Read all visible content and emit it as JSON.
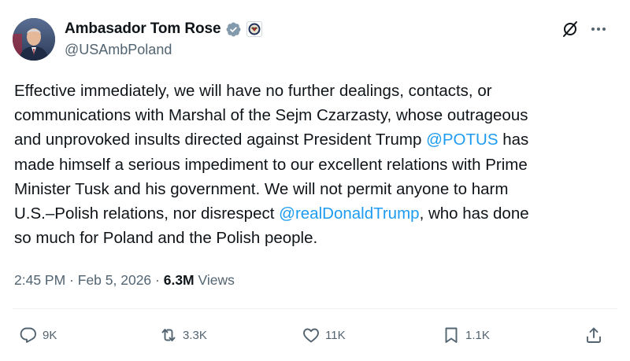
{
  "author": {
    "display_name": "Ambasador Tom Rose",
    "handle": "@USAmbPoland",
    "verified_icon": "verified-badge-icon",
    "affiliation_icon": "embassy-seal-icon"
  },
  "tweet": {
    "lines": [
      [
        "Effective immediately, we will have no further dealings, contacts, or"
      ],
      [
        "communications with Marshal of the Sejm Czarzasty, whose outrageous"
      ],
      [
        "and unprovoked insults directed  against President Trump ",
        "@POTUS",
        " has"
      ],
      [
        "made himself a serious impediment to our excellent relations with Prime"
      ],
      [
        "Minister Tusk and his government. We will not permit anyone to harm"
      ],
      [
        "U.S.–Polish relations, nor disrespect ",
        "@realDonaldTrump",
        ", who has done"
      ],
      [
        "so much for Poland and the Polish people."
      ]
    ]
  },
  "meta": {
    "time": "2:45 PM",
    "sep1": " · ",
    "date": "Feb 5, 2026",
    "sep2": " · ",
    "views_count": "6.3M",
    "views_label": " Views"
  },
  "actions": {
    "replies": "9K",
    "reposts": "3.3K",
    "likes": "11K",
    "bookmarks": "1.1K"
  },
  "colors": {
    "text": "#0f1419",
    "secondary": "#536471",
    "link": "#1d9bf0",
    "verified": "#829aab"
  }
}
